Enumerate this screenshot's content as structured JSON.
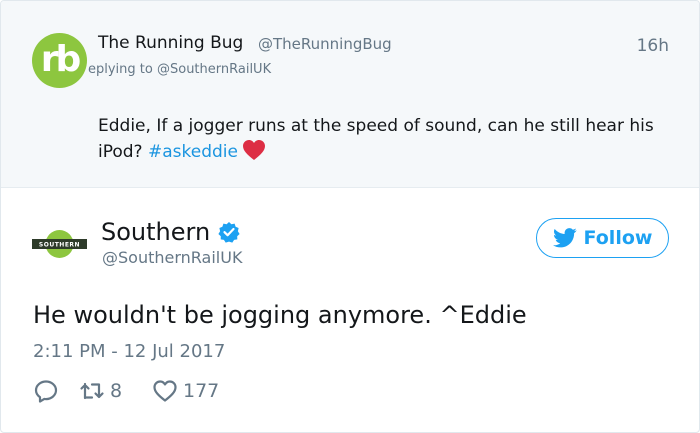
{
  "parent_tweet": {
    "avatar_text": "rb",
    "name": "The Running Bug",
    "handle": "@TheRunningBug",
    "time": "16h",
    "replying_prefix": "eplying to ",
    "replying_handle": "@SouthernRailUK",
    "text": "Eddie, If a jogger runs at the speed of sound, can he still hear his iPod? ",
    "hashtag": "#askeddie",
    "colors": {
      "avatar_bg": "#8dc63f",
      "hashtag": "#1b95e0"
    }
  },
  "tweet": {
    "avatar_label": "SOUTHERN",
    "author_name": "Southern",
    "author_handle": "@SouthernRailUK",
    "follow_label": "Follow",
    "text": "He wouldn't be jogging anymore. ^Eddie",
    "date": "2:11 PM - 12 Jul 2017",
    "retweet_count": "8",
    "like_count": "177",
    "icons": [
      "verified-badge-icon",
      "twitter-bird-icon",
      "reply-icon",
      "retweet-icon",
      "like-icon"
    ],
    "colors": {
      "accent": "#1da1f2",
      "muted": "#657786",
      "brand_green": "#8dc63f"
    }
  }
}
